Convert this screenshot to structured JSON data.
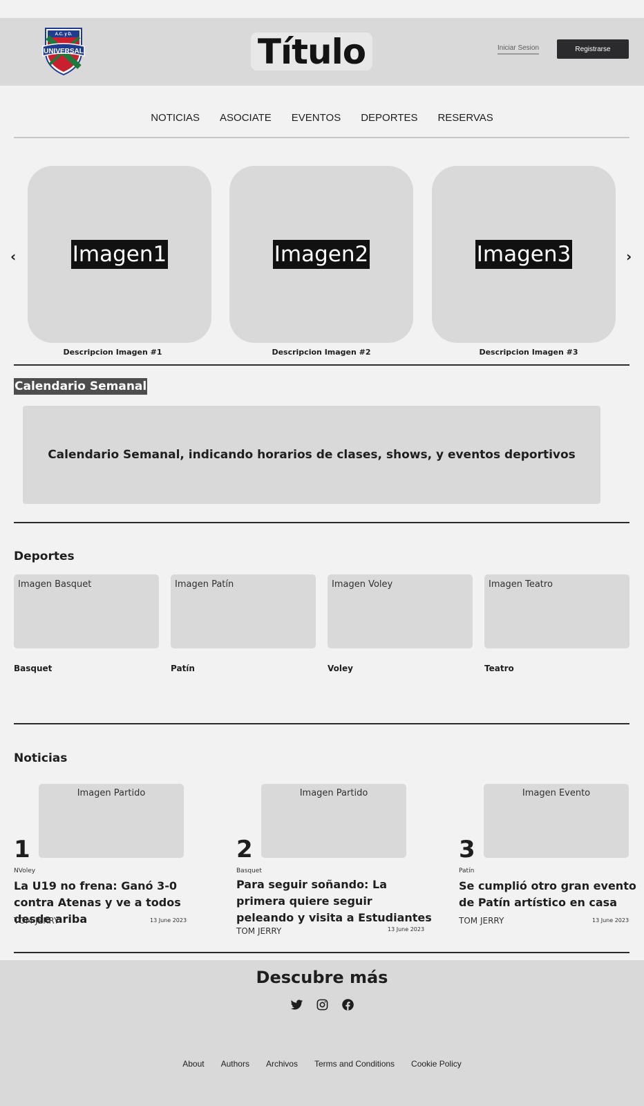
{
  "header": {
    "logo_text": "UNIVERSAL",
    "logo_small": "A.C. y D.",
    "title": "Título",
    "login_label": "Iniciar Sesion",
    "register_label": "Registrarse"
  },
  "nav": [
    "NOTICIAS",
    "ASOCIATE",
    "EVENTOS",
    "DEPORTES",
    "RESERVAS"
  ],
  "carousel": {
    "prev_icon": "chevron-left-icon",
    "next_icon": "chevron-right-icon",
    "slides": [
      {
        "label": "Imagen1",
        "caption": "Descripcion Imagen #1"
      },
      {
        "label": "Imagen2",
        "caption": "Descripcion Imagen #2"
      },
      {
        "label": "Imagen3",
        "caption": "Descripcion Imagen #3"
      }
    ]
  },
  "calendar": {
    "title": "Calendario Semanal",
    "body": "Calendario Semanal, indicando horarios de clases, shows, y eventos deportivos"
  },
  "sports": {
    "title": "Deportes",
    "items": [
      {
        "image_label": "Imagen Basquet",
        "name": "Basquet"
      },
      {
        "image_label": "Imagen Patín",
        "name": "Patín"
      },
      {
        "image_label": "Imagen Voley",
        "name": "Voley"
      },
      {
        "image_label": "Imagen Teatro",
        "name": "Teatro"
      }
    ]
  },
  "news": {
    "title": "Noticias",
    "items": [
      {
        "number": "1",
        "image_label": "Imagen Partido",
        "category": "NVoley",
        "headline": "La U19 no frena: Ganó 3-0 contra Atenas y ve a todos desde ariba",
        "author": "TOM JERRY",
        "date": "13 June 2023"
      },
      {
        "number": "2",
        "image_label": "Imagen Partido",
        "category": "Basquet",
        "headline": "Para seguir soñando: La primera quiere seguir peleando y visita a Estudiantes",
        "author": "TOM JERRY",
        "date": "13 June 2023"
      },
      {
        "number": "3",
        "image_label": "Imagen Evento",
        "category": "Patín",
        "headline": "Se cumplió otro gran evento de Patín artístico en casa",
        "author": "TOM JERRY",
        "date": "13 June 2023"
      }
    ]
  },
  "footer": {
    "title": "Descubre más",
    "social_icons": [
      "twitter-icon",
      "instagram-icon",
      "facebook-icon"
    ],
    "links": [
      "About",
      "Authors",
      "Archivos",
      "Terms and Conditions",
      "Cookie Policy"
    ]
  },
  "colors": {
    "background": "#f2f2f2",
    "panel": "#d9d9d9",
    "dark_button": "#2b2b2e",
    "logo_red": "#c8202f",
    "logo_blue": "#1f3c8f",
    "logo_green": "#1c7a3c"
  }
}
